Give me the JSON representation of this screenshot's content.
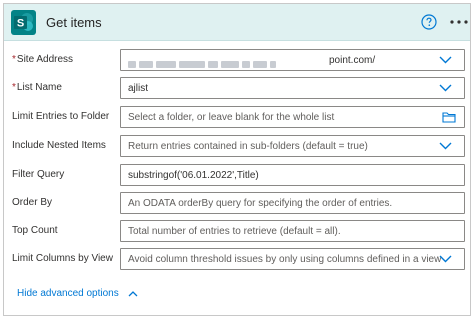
{
  "header": {
    "title": "Get items",
    "icon_letter": "S",
    "brand_color": "#038387",
    "help_icon": "help-circle-icon",
    "more_icon": "more-horizontal-icon"
  },
  "fields": {
    "site_address": {
      "label": "Site Address",
      "required": true,
      "value_visible_suffix": "point.com/"
    },
    "list_name": {
      "label": "List Name",
      "required": true,
      "value": "ajlist"
    },
    "limit_folder": {
      "label": "Limit Entries to Folder",
      "placeholder": "Select a folder, or leave blank for the whole list"
    },
    "nested_items": {
      "label": "Include Nested Items",
      "placeholder": "Return entries contained in sub-folders (default = true)"
    },
    "filter_query": {
      "label": "Filter Query",
      "value": "substringof('06.01.2022',Title)"
    },
    "order_by": {
      "label": "Order By",
      "placeholder": "An ODATA orderBy query for specifying the order of entries."
    },
    "top_count": {
      "label": "Top Count",
      "placeholder": "Total number of entries to retrieve (default = all)."
    },
    "limit_columns": {
      "label": "Limit Columns by View",
      "placeholder": "Avoid column threshold issues by only using columns defined in a view"
    }
  },
  "advanced_link": "Hide advanced options",
  "colors": {
    "accent": "#0078d4",
    "header_bg": "#dff1f1",
    "required": "#a4262c"
  }
}
